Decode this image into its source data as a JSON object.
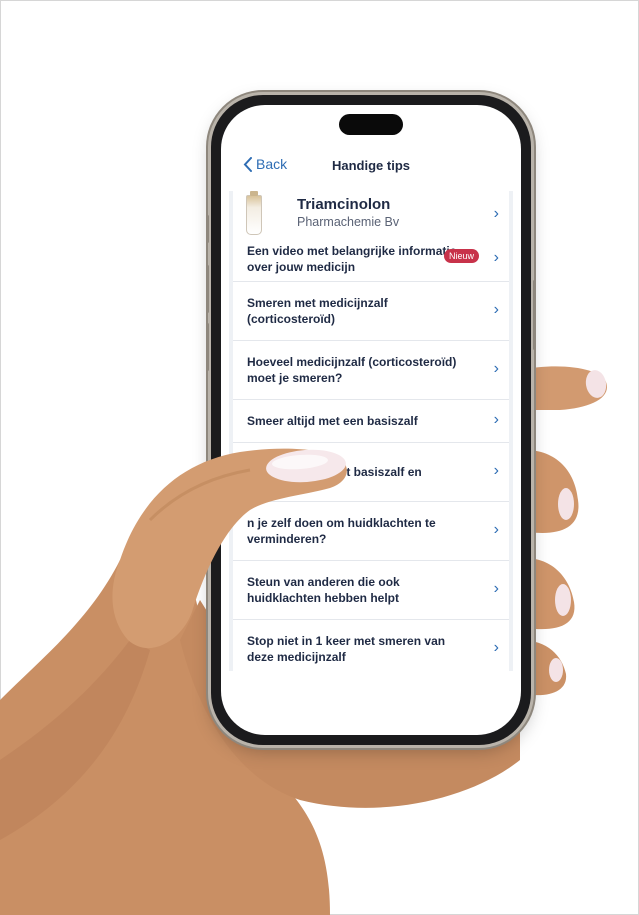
{
  "nav": {
    "back_label": "Back",
    "title": "Handige tips"
  },
  "product": {
    "name": "Triamcinolon",
    "manufacturer": "Pharmachemie Bv"
  },
  "tips": [
    {
      "label": "Een video met belangrijke informatie over jouw medicijn",
      "badge": "Nieuw"
    },
    {
      "label": "Smeren met medicijnzalf (corticosteroïd)"
    },
    {
      "label": "Hoeveel medicijnzalf (corticosteroïd) moet je smeren?"
    },
    {
      "label": "Smeer altijd met een basiszalf"
    },
    {
      "label": "met basiszalf en"
    },
    {
      "label": "n je zelf doen om huidklachten te verminderen?"
    },
    {
      "label": "Steun van anderen die ook huidklachten hebben helpt"
    },
    {
      "label": "Stop niet in 1 keer met smeren van deze medicijnzalf"
    }
  ],
  "colors": {
    "accent": "#2e6db4",
    "badge": "#c8324a",
    "text": "#1f2a44"
  }
}
